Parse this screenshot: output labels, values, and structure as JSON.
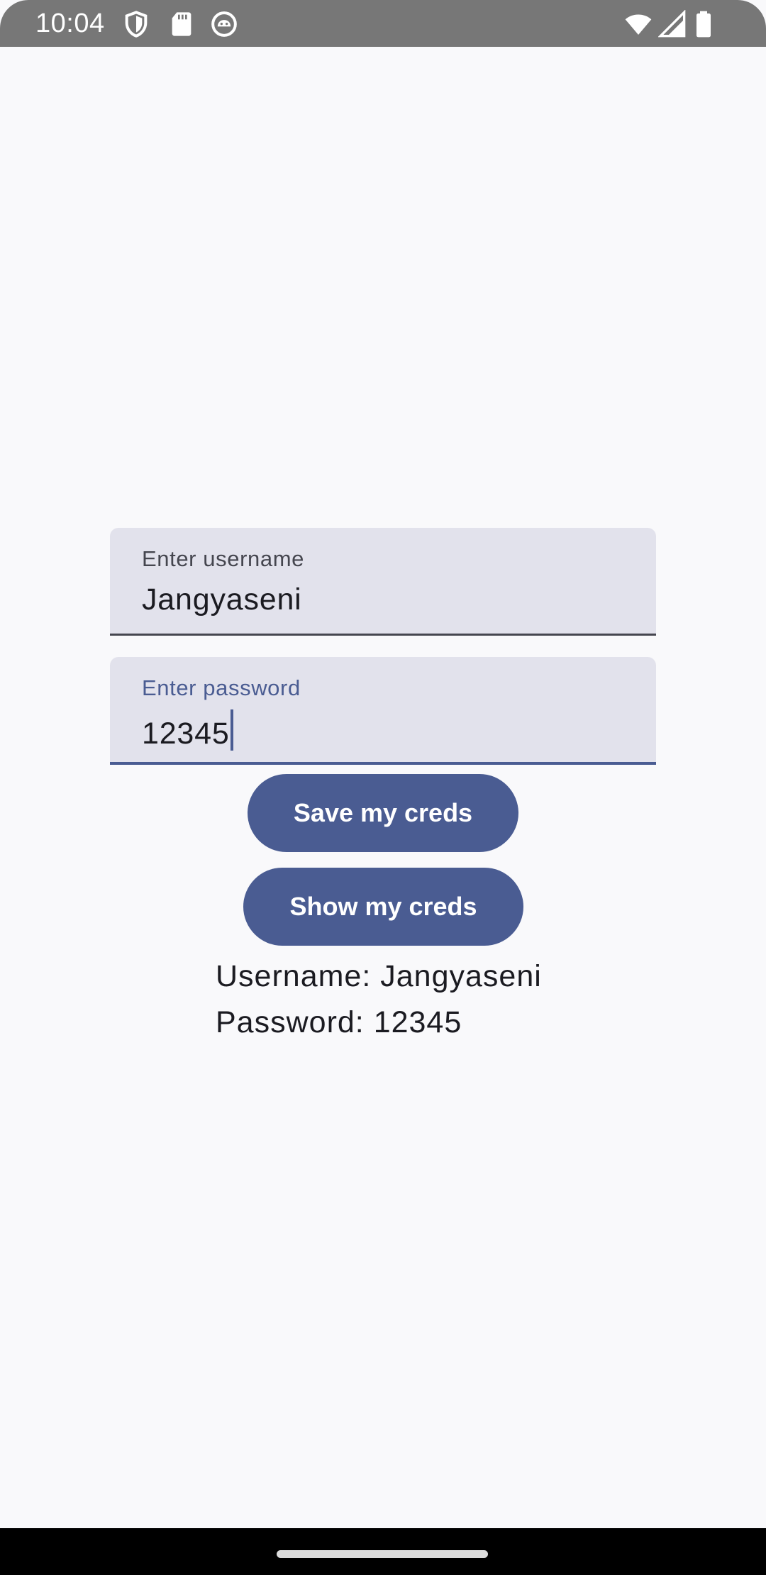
{
  "status_bar": {
    "time": "10:04",
    "icons_left": [
      "shield-icon",
      "sd-card-icon",
      "android-debug-icon"
    ],
    "icons_right": [
      "wifi-icon",
      "cell-signal-icon",
      "battery-icon"
    ],
    "background": "#777777"
  },
  "form": {
    "username": {
      "label": "Enter username",
      "value": "Jangyaseni"
    },
    "password": {
      "label": "Enter password",
      "value": "12345",
      "focused": true
    }
  },
  "buttons": {
    "save_label": "Save my creds",
    "show_label": "Show my creds"
  },
  "output": {
    "username_line": "Username: Jangyaseni",
    "password_line": "Password: 12345"
  },
  "colors": {
    "accent": "#4a5c92",
    "field_background": "#e2e2ec",
    "page_background": "#f9f9fb"
  }
}
